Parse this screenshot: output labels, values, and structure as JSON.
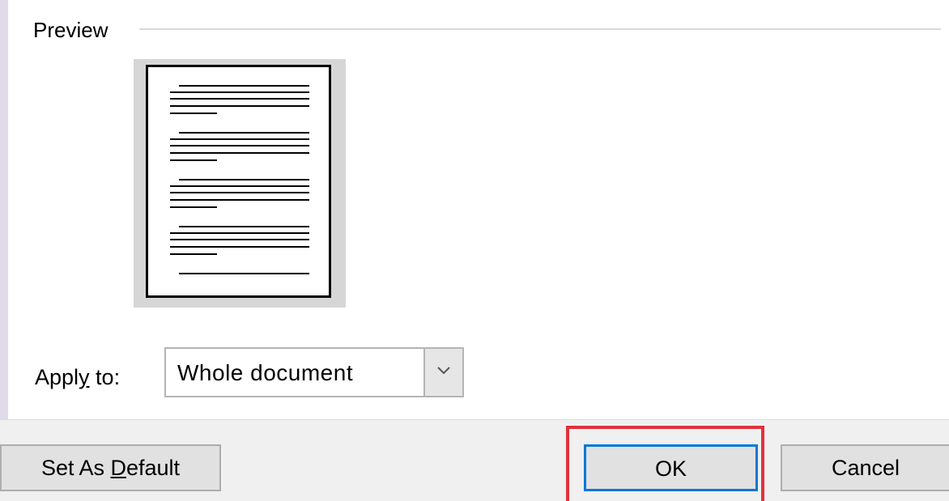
{
  "preview": {
    "title": "Preview"
  },
  "apply_to": {
    "label_before": "Appl",
    "label_accel": "y",
    "label_after": " to:",
    "selected": "Whole document"
  },
  "buttons": {
    "set_default_before": "Set As ",
    "set_default_accel": "D",
    "set_default_after": "efault",
    "ok": "OK",
    "cancel": "Cancel"
  },
  "colors": {
    "highlight": "#e0323c",
    "focus": "#0078d7"
  },
  "icons": {
    "dropdown": "chevron-down-icon",
    "page": "page-preview-icon"
  }
}
